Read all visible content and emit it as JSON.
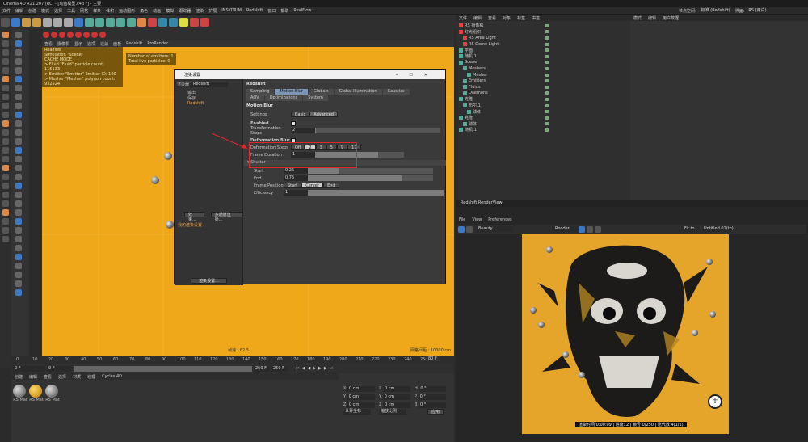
{
  "window_title": "Cinema 4D R21.207 (RC) - [动画模型.c4d *] - 主要",
  "menu": [
    "文件",
    "编辑",
    "创建",
    "模式",
    "选择",
    "工具",
    "网格",
    "样条",
    "体积",
    "运动图形",
    "角色",
    "动画",
    "模拟",
    "跟踪器",
    "渲染",
    "扩展",
    "INSYDIUM",
    "Redshift",
    "窗口",
    "帮助",
    "RealFlow"
  ],
  "right_menu": {
    "layout_label": "节点空间:",
    "layout_value": "标准 (Redshift)",
    "iface_label": "界面:",
    "iface_value": "RS (用户)"
  },
  "viewport_menu": [
    "查看",
    "摄像机",
    "显示",
    "选项",
    "过滤",
    "面板",
    "Redshift",
    "ProRender"
  ],
  "overlay": {
    "line0": "Realflow",
    "line1": "Simulation \"Scene\"",
    "line2": "CACHE MODE",
    "line3": "> Fluid \"Fluid\" particle count: 115133",
    "line4": "> Emitter \"Emitter\" Emitter ID: 100",
    "line5": "> Mesher \"Mesher\" polygon count: 932524",
    "emitters": "Number of emitters: 1",
    "total": "Total live particles: 0"
  },
  "viewport_footer": {
    "fps": "帧速 : 62.5",
    "grid": "网格间距 : 10000 cm"
  },
  "dialog": {
    "title": "渲染设置",
    "renderer_label": "渲染器",
    "renderer_value": "Redshift",
    "left_items": [
      "输出",
      "保存",
      "Redshift"
    ],
    "effect_btn": "效果...",
    "multipass_btn": "多通道渲染...",
    "preset_item": "我的渲染设置",
    "render_settings_btn": "渲染设置...",
    "section": "Redshift",
    "tabs_row1": [
      "Sampling",
      "Motion Blur",
      "Globals",
      "Global Illumination",
      "Caustics"
    ],
    "tabs_row2": [
      "AOV",
      "Optimizations",
      "System"
    ],
    "active_tab": "Motion Blur",
    "mb_header": "Motion Blur",
    "settings_label": "Settings",
    "basic": "Basic",
    "advanced": "Advanced",
    "enabled_label": "Enabled",
    "trans_steps_label": "Transformation Steps",
    "trans_steps_value": "2",
    "deform_blur_label": "Deformation Blur",
    "deform_steps_label": "Deformation Steps",
    "deform_steps": [
      "Off",
      "2",
      "3",
      "5",
      "9",
      "17"
    ],
    "frame_duration_label": "Frame Duration",
    "frame_duration_value": "1",
    "shutter_label": "▾ Shutter",
    "start_label": "Start",
    "start_value": "0.25",
    "end_label": "End",
    "end_value": "0.75",
    "frame_pos_label": "Frame Position",
    "frame_pos": [
      "Start",
      "Center",
      "End"
    ],
    "efficiency_label": "Efficiency",
    "efficiency_value": "1"
  },
  "timeline": {
    "ticks": [
      "0",
      "10",
      "20",
      "30",
      "40",
      "50",
      "60",
      "70",
      "80",
      "90",
      "100",
      "110",
      "120",
      "130",
      "140",
      "150",
      "160",
      "170",
      "180",
      "190",
      "200",
      "210",
      "220",
      "230",
      "240",
      "250"
    ],
    "current": "80 F",
    "start": "0 F",
    "start2": "0 F",
    "end": "250 F",
    "end2": "250 F"
  },
  "material_menu": [
    "创建",
    "编辑",
    "查看",
    "选择",
    "材质",
    "纹理",
    "Cycles 4D"
  ],
  "materials": [
    "RS Mat",
    "RS Mat",
    "RS Mat"
  ],
  "coords": {
    "x": "X",
    "y": "Y",
    "z": "Z",
    "x_val": "0 cm",
    "h": "H",
    "p": "P",
    "b": "B",
    "deg": "0 °",
    "world": "世界坐标",
    "scale": "缩放比例",
    "apply": "应用"
  },
  "obj_menu": [
    "文件",
    "编辑",
    "查看",
    "对象",
    "标签",
    "书签"
  ],
  "objects": [
    "RS 摄像机",
    "灯光组织",
    "RS Area Light",
    "RS Dome Light",
    "平面",
    "随机.1",
    "Scene",
    "Meshers",
    "Mesher",
    "Emitters",
    "Fluids",
    "Daemons",
    "克隆",
    "布尔.1",
    "球体",
    "克隆",
    "球体",
    "随机.1"
  ],
  "attr_menu": [
    "模式",
    "编辑",
    "用户数据"
  ],
  "renderview": {
    "title": "Redshift RenderView",
    "menu": [
      "File",
      "View",
      "Preferences"
    ],
    "aov": "Beauty",
    "camera": "Render",
    "zoom": "Fit to",
    "display": "Untitled 01(to)",
    "status": "渲染时间 0:00:09 | 进度: 2 | 帧号 0/250 | 迭代数 4(1/1)"
  }
}
